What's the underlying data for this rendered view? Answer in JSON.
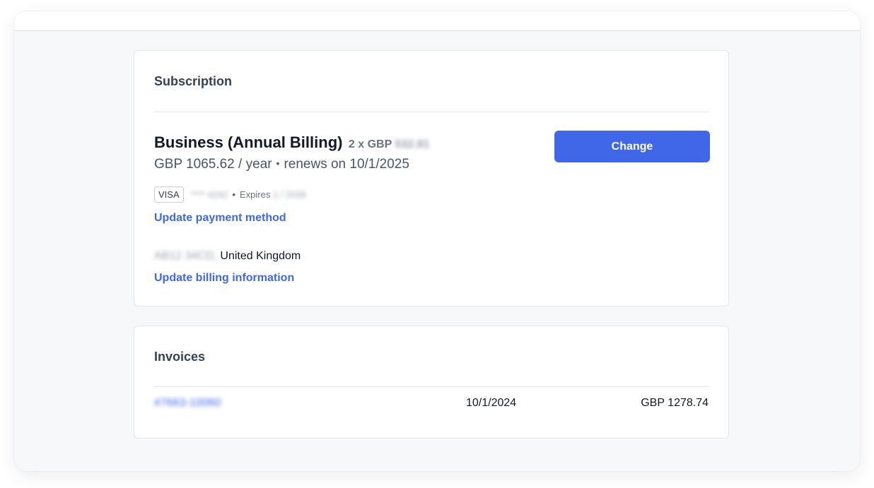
{
  "subscription": {
    "title": "Subscription",
    "plan_name": "Business (Annual Billing)",
    "plan_qty_prefix": "2 x GBP",
    "plan_unit_price": "532.81",
    "price": "GBP 1065.62 / year",
    "dot": "•",
    "renewal": "renews on 10/1/2025",
    "change_label": "Change",
    "card": {
      "brand": "VISA",
      "masked_number": "**** 4242",
      "separator": "•",
      "expires_label": "Expires",
      "expiry": "1 / 2028"
    },
    "update_payment_label": "Update payment method",
    "address_postcode": "AB12 34CD,",
    "address_country": "United Kingdom",
    "update_billing_label": "Update billing information"
  },
  "invoices": {
    "title": "Invoices",
    "rows": [
      {
        "id": "#7663-10060",
        "date": "10/1/2024",
        "amount": "GBP 1278.74"
      }
    ]
  },
  "colors": {
    "accent": "#3f67e8",
    "background": "#f7f8fa"
  }
}
